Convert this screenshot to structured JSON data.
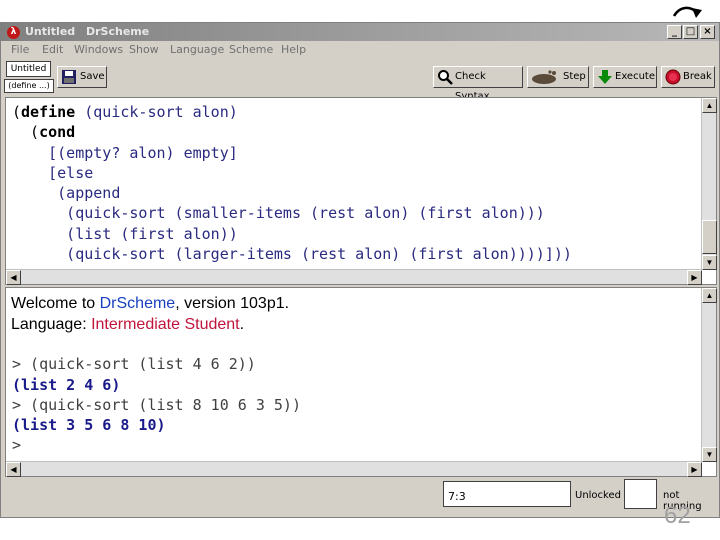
{
  "window": {
    "title": "Untitled",
    "app_name": "DrScheme",
    "app_icon_glyph": "λ",
    "controls": [
      "_",
      "□",
      "×"
    ]
  },
  "menu": [
    "File",
    "Edit",
    "Windows",
    "Show",
    "Language",
    "Scheme",
    "Help"
  ],
  "toolbar": {
    "file_name": "Untitled",
    "define_menu": "(define ...)",
    "save_label": "Save",
    "check_syntax_label": "Check Syntax",
    "step_label": "Step",
    "execute_label": "Execute",
    "break_label": "Break"
  },
  "definitions": [
    "(define (quick-sort alon)",
    "  (cond",
    "    [(empty? alon) empty]",
    "    [else",
    "     (append",
    "      (quick-sort (smaller-items (rest alon) (first alon)))",
    "      (list (first alon))",
    "      (quick-sort (larger-items (rest alon) (first alon))))]))"
  ],
  "interactions": {
    "welcome_prefix": "Welcome to ",
    "welcome_link": "DrScheme",
    "welcome_suffix": ", version 103p1.",
    "language_prefix": "Language: ",
    "language_name": "Intermediate Student",
    "language_suffix": ".",
    "lines": [
      {
        "kind": "input",
        "text": "> (quick-sort (list 4 6 2))"
      },
      {
        "kind": "output",
        "text": "(list 2 4 6)"
      },
      {
        "kind": "input",
        "text": "> (quick-sort (list 8 10 6 3 5))"
      },
      {
        "kind": "output",
        "text": "(list 3 5 6 8 10)"
      },
      {
        "kind": "input",
        "text": ">"
      }
    ]
  },
  "status": {
    "position": "7:3",
    "lock": "Unlocked",
    "running": "not running"
  },
  "page_number": "62"
}
